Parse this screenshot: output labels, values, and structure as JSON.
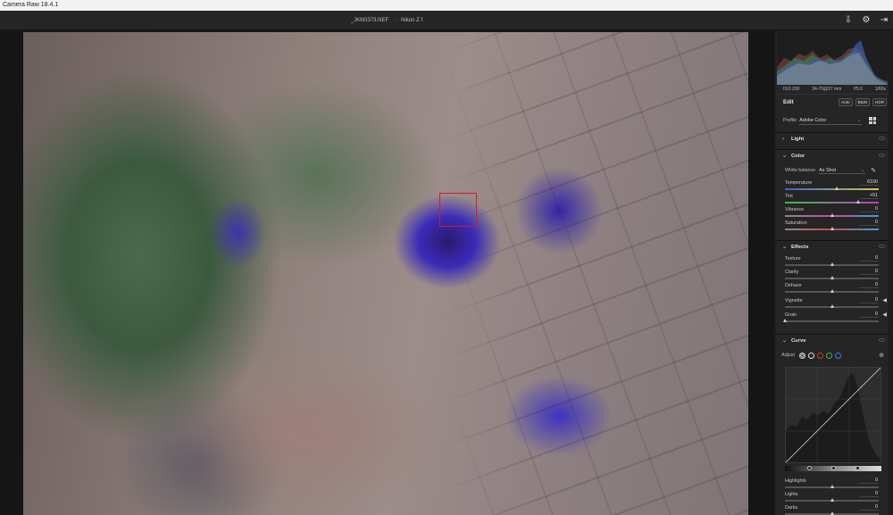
{
  "app": {
    "title": "Camera Raw 18.4.1"
  },
  "topbar": {
    "filename": "_JKM3373.NEF",
    "camera": "Nikon Z f",
    "icons": [
      "export-icon",
      "gear-icon",
      "exit-icon"
    ]
  },
  "exif": {
    "iso": "ISO 200",
    "lens": "24-70@37 mm",
    "aperture": "f/5.6",
    "shutter": "1/60s"
  },
  "edit": {
    "title": "Edit",
    "auto_label": "Auto",
    "bw_label": "B&W",
    "hdr_label": "HDR"
  },
  "profile": {
    "label": "Profile",
    "value": "Adobe Color"
  },
  "sections": {
    "light": "Light",
    "color": "Color",
    "effects": "Effects",
    "curve": "Curve"
  },
  "white_balance": {
    "label": "White balance",
    "value": "As Shot"
  },
  "color_sliders": [
    {
      "label": "Temperature",
      "value": "6100",
      "pos": 0.55
    },
    {
      "label": "Tint",
      "value": "+51",
      "pos": 0.78
    },
    {
      "label": "Vibrance",
      "value": "0",
      "pos": 0.5
    },
    {
      "label": "Saturation",
      "value": "0",
      "pos": 0.5
    }
  ],
  "effects_sliders": [
    {
      "label": "Texture",
      "value": "0",
      "pos": 0.5
    },
    {
      "label": "Clarity",
      "value": "0",
      "pos": 0.5
    },
    {
      "label": "Dehaze",
      "value": "0",
      "pos": 0.5
    },
    {
      "label": "Vignette",
      "value": "0",
      "pos": 0.5
    },
    {
      "label": "Grain",
      "value": "0",
      "pos": 0.0
    }
  ],
  "curve": {
    "adjust_label": "Adjust",
    "channel_colors": [
      "#dddddd",
      "#d03434",
      "#3fae3f",
      "#3c7fe0"
    ]
  },
  "curve_sliders": [
    {
      "label": "Highlights",
      "value": "0",
      "pos": 0.5
    },
    {
      "label": "Lights",
      "value": "0",
      "pos": 0.5
    },
    {
      "label": "Darks",
      "value": "0",
      "pos": 0.5
    }
  ]
}
